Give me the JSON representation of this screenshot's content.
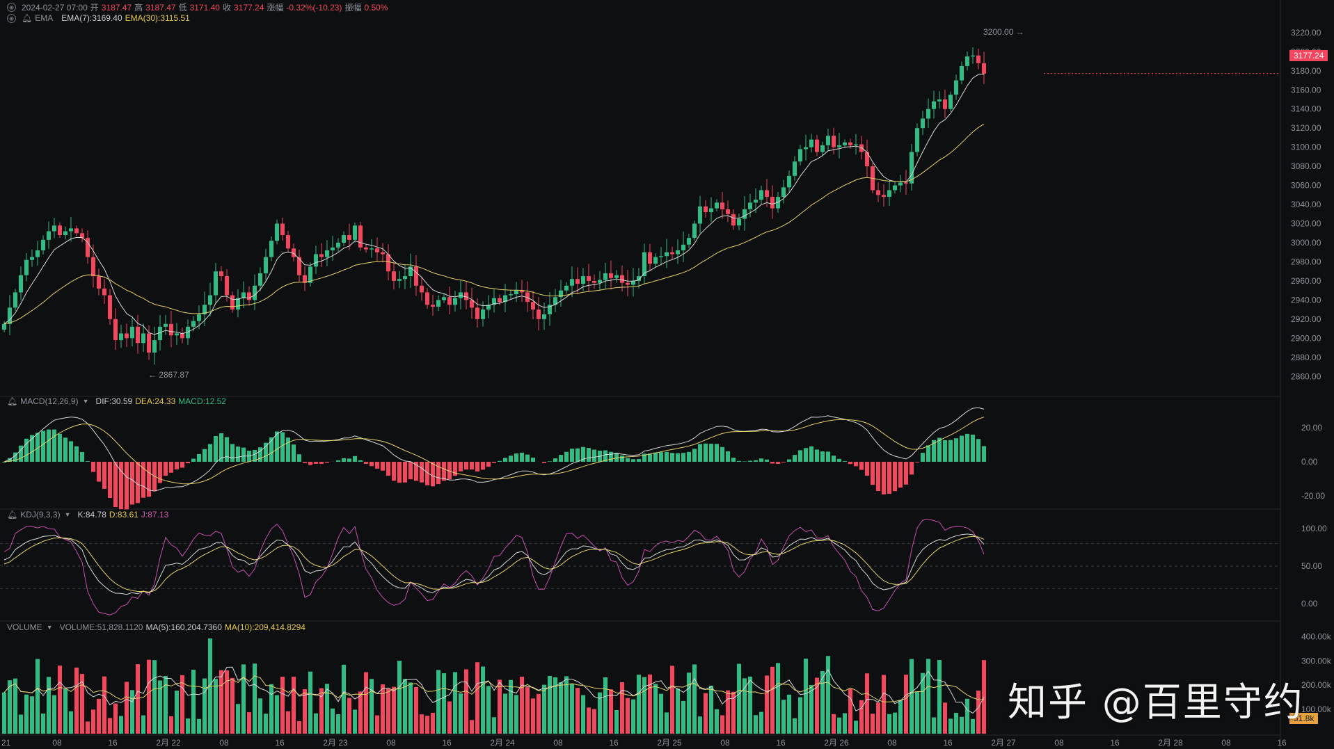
{
  "ohlc_legend": {
    "time": "2024-02-27 07:00",
    "open_label": "开",
    "open": "3187.47",
    "high_label": "高",
    "high": "3187.47",
    "low_label": "低",
    "low": "3171.40",
    "close_label": "收",
    "close": "3177.24",
    "change_label": "涨幅",
    "change": "-0.32%(-10.23)",
    "amp_label": "振幅",
    "amp": "0.50%"
  },
  "ema_legend": {
    "name": "EMA",
    "ema7": "EMA(7):3169.40",
    "ema30": "EMA(30):3115.51"
  },
  "macd_legend": {
    "name": "MACD(12,26,9)",
    "dif": "DIF:30.59",
    "dea": "DEA:24.33",
    "macd": "MACD:12.52"
  },
  "kdj_legend": {
    "name": "KDJ(9,3,3)",
    "k": "K:84.78",
    "d": "D:83.61",
    "j": "J:87.13"
  },
  "volume_legend": {
    "name": "VOLUME",
    "volume": "VOLUME:51,828.1120",
    "ma5": "MA(5):160,204.7360",
    "ma10": "MA(10):209,414.8294"
  },
  "annotations": {
    "high": "3200.00 →",
    "low": "← 2867.87"
  },
  "price_axis": [
    "3220.00",
    "3200.00",
    "3180.00",
    "3160.00",
    "3140.00",
    "3120.00",
    "3100.00",
    "3080.00",
    "3060.00",
    "3040.00",
    "3020.00",
    "3000.00",
    "2980.00",
    "2960.00",
    "2940.00",
    "2920.00",
    "2900.00",
    "2880.00",
    "2860.00"
  ],
  "current_price": "3177.24",
  "macd_axis": [
    "20.00",
    "0.00",
    "-20.00"
  ],
  "kdj_axis": [
    "100.00",
    "50.00",
    "0.00"
  ],
  "volume_axis": [
    "400.00k",
    "300.00k",
    "200.00k",
    "100.00k"
  ],
  "current_volume": "51.8k",
  "time_axis": [
    "21",
    "08",
    "16",
    "2月 22",
    "08",
    "16",
    "2月 23",
    "08",
    "16",
    "2月 24",
    "08",
    "16",
    "2月 25",
    "08",
    "16",
    "2月 26",
    "08",
    "16",
    "2月 27",
    "08",
    "16",
    "2月 28",
    "08",
    "16"
  ],
  "watermark": "知乎 @百里守约",
  "colors": {
    "up": "#2ebd85",
    "down": "#f6465d",
    "ema7": "#d9d9d9",
    "ema30": "#e6d36a",
    "kdj_j": "#c84fb0",
    "bg": "#0e0f11",
    "grid": "#1c1e22"
  },
  "chart_data": {
    "type": "candlestick",
    "interval": "1h",
    "price_range": [
      2850,
      3225
    ],
    "closes": [
      2915,
      2932,
      2948,
      2966,
      2982,
      2985,
      2992,
      3003,
      3012,
      3018,
      3008,
      3012,
      3015,
      3010,
      3005,
      2985,
      2965,
      2952,
      2945,
      2920,
      2898,
      2905,
      2900,
      2912,
      2895,
      2905,
      2885,
      2898,
      2912,
      2915,
      2903,
      2905,
      2900,
      2912,
      2918,
      2925,
      2935,
      2945,
      2970,
      2965,
      2945,
      2930,
      2942,
      2948,
      2940,
      2955,
      2968,
      2985,
      3002,
      3020,
      3008,
      2994,
      2985,
      2966,
      2958,
      2975,
      2988,
      2985,
      2992,
      2995,
      3000,
      3008,
      3003,
      3018,
      2995,
      2993,
      2994,
      2990,
      2988,
      2970,
      2960,
      2962,
      2965,
      2975,
      2955,
      2948,
      2935,
      2933,
      2940,
      2943,
      2935,
      2942,
      2948,
      2940,
      2932,
      2920,
      2930,
      2935,
      2942,
      2938,
      2945,
      2946,
      2950,
      2948,
      2938,
      2930,
      2920,
      2925,
      2935,
      2943,
      2950,
      2955,
      2962,
      2957,
      2965,
      2960,
      2958,
      2961,
      2968,
      2963,
      2966,
      2958,
      2956,
      2960,
      2965,
      2990,
      2978,
      2985,
      2986,
      2990,
      2988,
      2992,
      2998,
      3005,
      3020,
      3038,
      3032,
      3036,
      3042,
      3035,
      3030,
      3018,
      3025,
      3035,
      3042,
      3045,
      3055,
      3048,
      3036,
      3048,
      3058,
      3070,
      3085,
      3098,
      3100,
      3108,
      3095,
      3102,
      3112,
      3100,
      3102,
      3105,
      3102,
      3103,
      3095,
      3080,
      3055,
      3050,
      3048,
      3055,
      3060,
      3063,
      3062,
      3095,
      3120,
      3130,
      3140,
      3148,
      3150,
      3140,
      3155,
      3170,
      3185,
      3195,
      3196,
      3188,
      3177
    ]
  }
}
